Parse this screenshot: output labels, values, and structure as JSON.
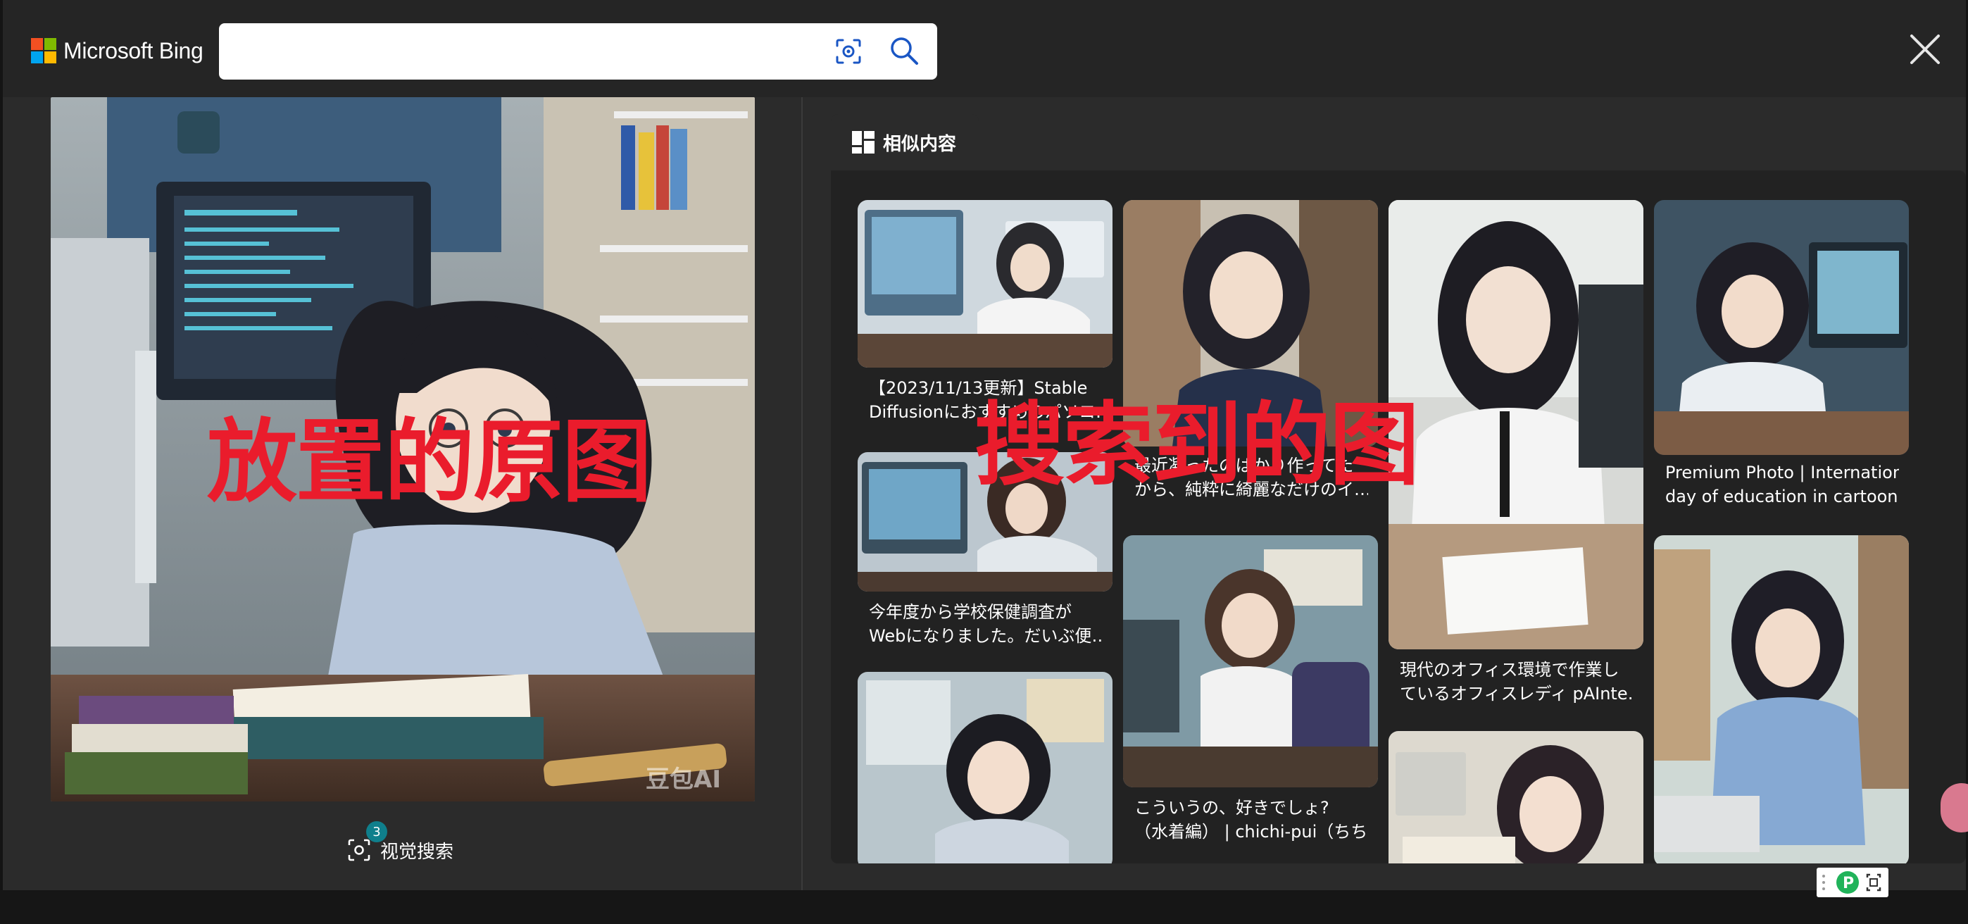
{
  "header": {
    "brand": "Microsoft Bing",
    "search_value": "",
    "close_label": "×"
  },
  "left_panel": {
    "watermark": "豆包AI",
    "visual_search_label": "视觉搜索",
    "visual_search_count": "3",
    "overlay_text": "放置的原图"
  },
  "right_panel": {
    "tab_label": "相似内容",
    "overlay_text": "搜索到的图",
    "cards": [
      {
        "caption": "【2023/11/13更新】Stable\nDiffusionにおすすめのパソコ…"
      },
      {
        "caption": "今年度から学校保健調査が\nWebになりました。だいぶ便…"
      },
      {
        "caption": ""
      },
      {
        "caption": "最近凝ったのばかり作ってた\nから、純粋に綺麗なだけのイ…"
      },
      {
        "caption": "こういうの、好きでしょ?\n（水着編） | chichi-pui（ちち…"
      },
      {
        "caption": "現代のオフィス環境で作業し\nているオフィスレディ pAInte…"
      },
      {
        "caption": ""
      },
      {
        "caption": "Premium Photo | International\nday of education in cartoon…"
      },
      {
        "caption": ""
      }
    ]
  },
  "colors": {
    "background": "#2b2b2b",
    "topbar": "#252525",
    "overlay_red": "#ea1c2c",
    "badge": "#0f7f8c",
    "ms_red": "#f25022",
    "ms_green": "#7fba00",
    "ms_blue": "#00a4ef",
    "ms_yellow": "#ffb900"
  }
}
